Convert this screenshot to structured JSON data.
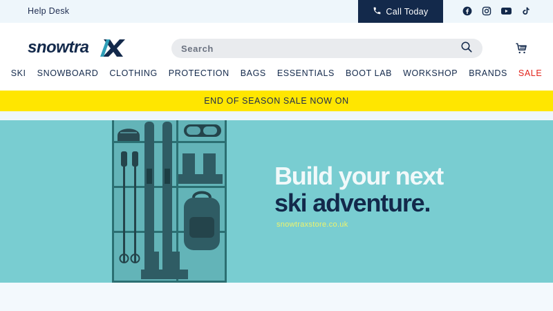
{
  "topbar": {
    "help_label": "Help Desk",
    "call_label": "Call Today",
    "socials": [
      "facebook-icon",
      "instagram-icon",
      "youtube-icon",
      "tiktok-icon"
    ]
  },
  "header": {
    "logo_text": "snowtrax",
    "search_placeholder": "Search"
  },
  "nav": {
    "items": [
      "SKI",
      "SNOWBOARD",
      "CLOTHING",
      "PROTECTION",
      "BAGS",
      "ESSENTIALS",
      "BOOT LAB",
      "WORKSHOP",
      "BRANDS",
      "SALE"
    ]
  },
  "banner": {
    "text": "END OF SEASON SALE NOW ON"
  },
  "hero": {
    "headline_line1": "Build your next",
    "headline_line2": "ski adventure.",
    "url": "snowtraxstore.co.uk"
  },
  "colors": {
    "navy": "#13294b",
    "banner_yellow": "#ffe600",
    "hero_teal": "#79cdd1",
    "sale_red": "#e2231a"
  }
}
